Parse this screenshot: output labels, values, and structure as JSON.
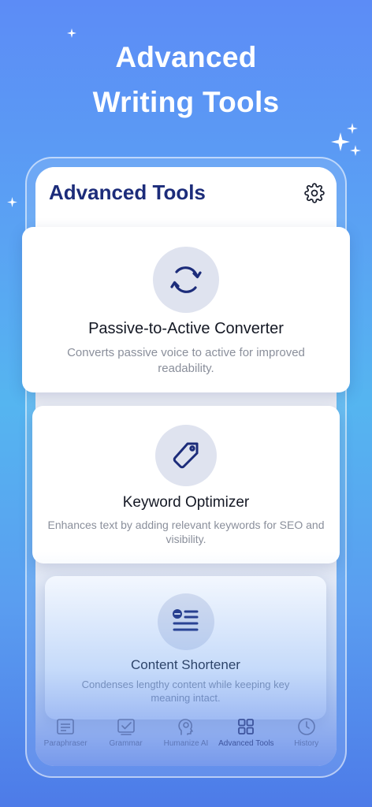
{
  "headline": {
    "line1": "Advanced",
    "line2": "Writing Tools"
  },
  "screen": {
    "title": "Advanced Tools",
    "settings_icon": "gear-icon"
  },
  "cards": [
    {
      "icon": "refresh-icon",
      "title": "Passive-to-Active Converter",
      "description": "Converts passive voice to active for improved readability."
    },
    {
      "icon": "tag-icon",
      "title": "Keyword Optimizer",
      "description": "Enhances text by adding relevant keywords for SEO and visibility."
    },
    {
      "icon": "text-shorten-icon",
      "title": "Content Shortener",
      "description": "Condenses lengthy content while keeping key meaning intact."
    }
  ],
  "tabbar": {
    "items": [
      {
        "label": "Paraphraser",
        "icon": "document-icon"
      },
      {
        "label": "Grammar",
        "icon": "checkbox-icon"
      },
      {
        "label": "Humanize AI",
        "icon": "brain-head-icon"
      },
      {
        "label": "Advanced Tools",
        "icon": "grid-icon",
        "active": true
      },
      {
        "label": "History",
        "icon": "clock-icon"
      }
    ]
  },
  "colors": {
    "accent": "#1c2c7a",
    "background_top": "#5c8cf6",
    "background_mid": "#55b5f0",
    "icon_circle": "#dfe3ef"
  }
}
